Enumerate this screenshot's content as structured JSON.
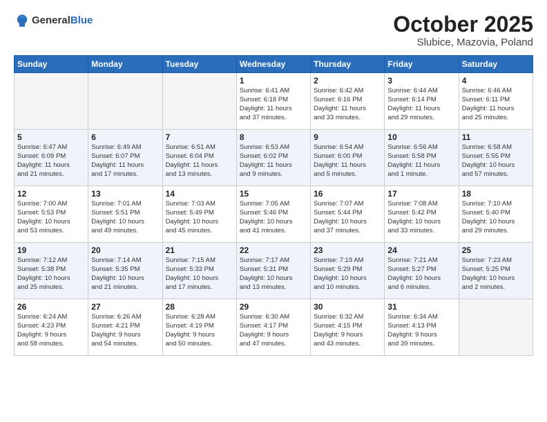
{
  "header": {
    "logo": {
      "general": "General",
      "blue": "Blue"
    },
    "title": "October 2025",
    "location": "Slubice, Mazovia, Poland"
  },
  "weekdays": [
    "Sunday",
    "Monday",
    "Tuesday",
    "Wednesday",
    "Thursday",
    "Friday",
    "Saturday"
  ],
  "weeks": [
    [
      {
        "day": "",
        "content": ""
      },
      {
        "day": "",
        "content": ""
      },
      {
        "day": "",
        "content": ""
      },
      {
        "day": "1",
        "content": "Sunrise: 6:41 AM\nSunset: 6:18 PM\nDaylight: 11 hours\nand 37 minutes."
      },
      {
        "day": "2",
        "content": "Sunrise: 6:42 AM\nSunset: 6:16 PM\nDaylight: 11 hours\nand 33 minutes."
      },
      {
        "day": "3",
        "content": "Sunrise: 6:44 AM\nSunset: 6:14 PM\nDaylight: 11 hours\nand 29 minutes."
      },
      {
        "day": "4",
        "content": "Sunrise: 6:46 AM\nSunset: 6:11 PM\nDaylight: 11 hours\nand 25 minutes."
      }
    ],
    [
      {
        "day": "5",
        "content": "Sunrise: 6:47 AM\nSunset: 6:09 PM\nDaylight: 11 hours\nand 21 minutes."
      },
      {
        "day": "6",
        "content": "Sunrise: 6:49 AM\nSunset: 6:07 PM\nDaylight: 11 hours\nand 17 minutes."
      },
      {
        "day": "7",
        "content": "Sunrise: 6:51 AM\nSunset: 6:04 PM\nDaylight: 11 hours\nand 13 minutes."
      },
      {
        "day": "8",
        "content": "Sunrise: 6:53 AM\nSunset: 6:02 PM\nDaylight: 11 hours\nand 9 minutes."
      },
      {
        "day": "9",
        "content": "Sunrise: 6:54 AM\nSunset: 6:00 PM\nDaylight: 11 hours\nand 5 minutes."
      },
      {
        "day": "10",
        "content": "Sunrise: 6:56 AM\nSunset: 5:58 PM\nDaylight: 11 hours\nand 1 minute."
      },
      {
        "day": "11",
        "content": "Sunrise: 6:58 AM\nSunset: 5:55 PM\nDaylight: 10 hours\nand 57 minutes."
      }
    ],
    [
      {
        "day": "12",
        "content": "Sunrise: 7:00 AM\nSunset: 5:53 PM\nDaylight: 10 hours\nand 53 minutes."
      },
      {
        "day": "13",
        "content": "Sunrise: 7:01 AM\nSunset: 5:51 PM\nDaylight: 10 hours\nand 49 minutes."
      },
      {
        "day": "14",
        "content": "Sunrise: 7:03 AM\nSunset: 5:49 PM\nDaylight: 10 hours\nand 45 minutes."
      },
      {
        "day": "15",
        "content": "Sunrise: 7:05 AM\nSunset: 5:46 PM\nDaylight: 10 hours\nand 41 minutes."
      },
      {
        "day": "16",
        "content": "Sunrise: 7:07 AM\nSunset: 5:44 PM\nDaylight: 10 hours\nand 37 minutes."
      },
      {
        "day": "17",
        "content": "Sunrise: 7:08 AM\nSunset: 5:42 PM\nDaylight: 10 hours\nand 33 minutes."
      },
      {
        "day": "18",
        "content": "Sunrise: 7:10 AM\nSunset: 5:40 PM\nDaylight: 10 hours\nand 29 minutes."
      }
    ],
    [
      {
        "day": "19",
        "content": "Sunrise: 7:12 AM\nSunset: 5:38 PM\nDaylight: 10 hours\nand 25 minutes."
      },
      {
        "day": "20",
        "content": "Sunrise: 7:14 AM\nSunset: 5:35 PM\nDaylight: 10 hours\nand 21 minutes."
      },
      {
        "day": "21",
        "content": "Sunrise: 7:15 AM\nSunset: 5:33 PM\nDaylight: 10 hours\nand 17 minutes."
      },
      {
        "day": "22",
        "content": "Sunrise: 7:17 AM\nSunset: 5:31 PM\nDaylight: 10 hours\nand 13 minutes."
      },
      {
        "day": "23",
        "content": "Sunrise: 7:19 AM\nSunset: 5:29 PM\nDaylight: 10 hours\nand 10 minutes."
      },
      {
        "day": "24",
        "content": "Sunrise: 7:21 AM\nSunset: 5:27 PM\nDaylight: 10 hours\nand 6 minutes."
      },
      {
        "day": "25",
        "content": "Sunrise: 7:23 AM\nSunset: 5:25 PM\nDaylight: 10 hours\nand 2 minutes."
      }
    ],
    [
      {
        "day": "26",
        "content": "Sunrise: 6:24 AM\nSunset: 4:23 PM\nDaylight: 9 hours\nand 58 minutes."
      },
      {
        "day": "27",
        "content": "Sunrise: 6:26 AM\nSunset: 4:21 PM\nDaylight: 9 hours\nand 54 minutes."
      },
      {
        "day": "28",
        "content": "Sunrise: 6:28 AM\nSunset: 4:19 PM\nDaylight: 9 hours\nand 50 minutes."
      },
      {
        "day": "29",
        "content": "Sunrise: 6:30 AM\nSunset: 4:17 PM\nDaylight: 9 hours\nand 47 minutes."
      },
      {
        "day": "30",
        "content": "Sunrise: 6:32 AM\nSunset: 4:15 PM\nDaylight: 9 hours\nand 43 minutes."
      },
      {
        "day": "31",
        "content": "Sunrise: 6:34 AM\nSunset: 4:13 PM\nDaylight: 9 hours\nand 39 minutes."
      },
      {
        "day": "",
        "content": ""
      }
    ]
  ]
}
